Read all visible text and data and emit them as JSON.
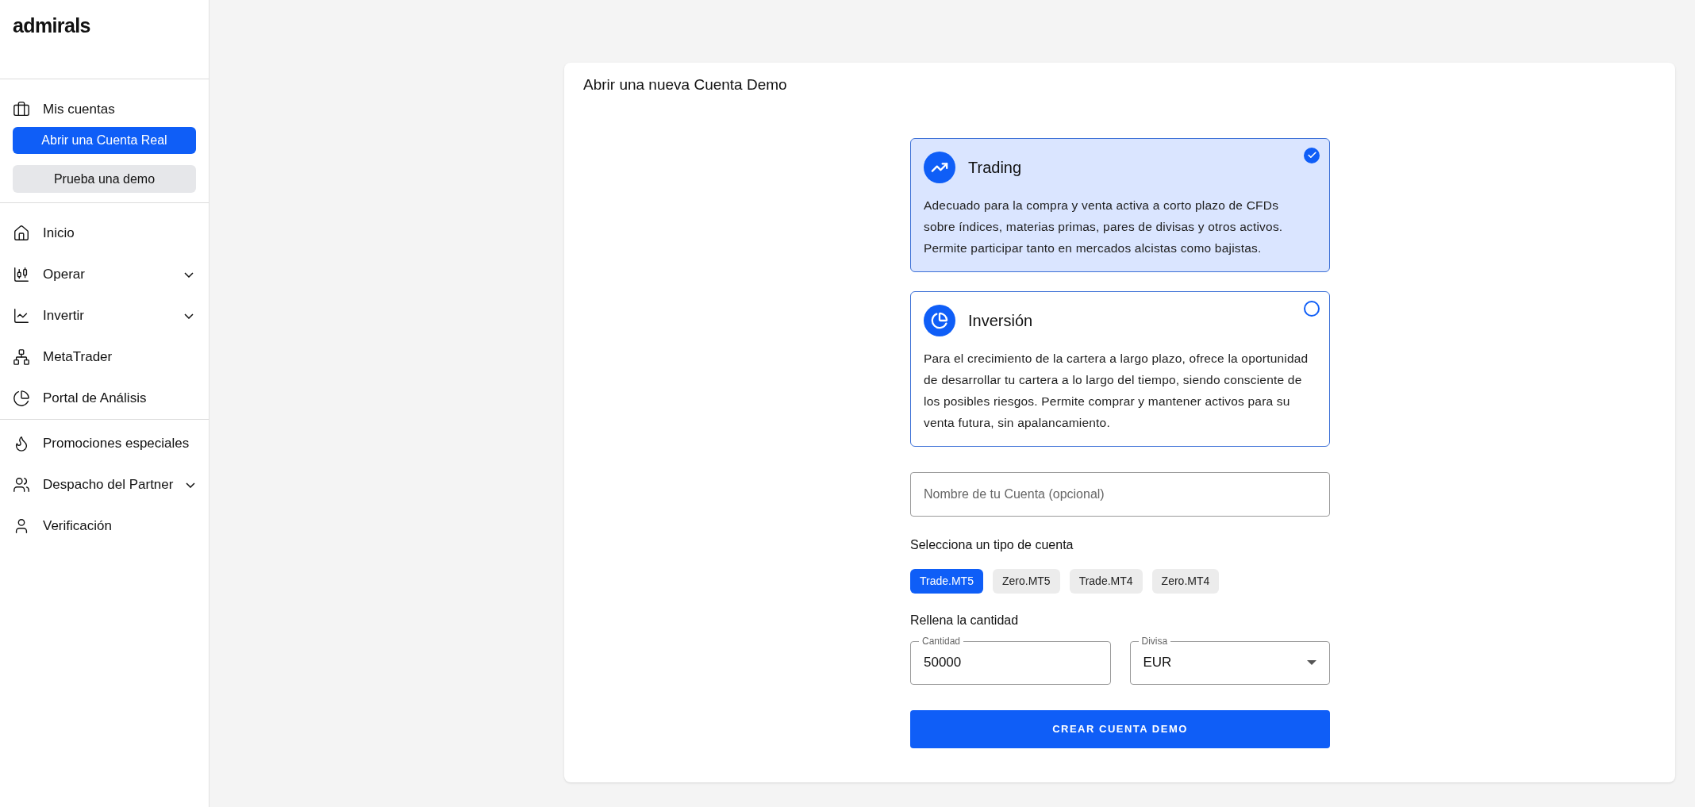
{
  "logo": "admirals",
  "sidebar": {
    "accounts": {
      "label": "Mis cuentas"
    },
    "buttons": [
      {
        "label": "Abrir una Cuenta Real",
        "kind": "primary"
      },
      {
        "label": "Prueba una demo",
        "kind": "secondary"
      }
    ],
    "groups": [
      [
        {
          "label": "Inicio",
          "expandable": false
        },
        {
          "label": "Operar",
          "expandable": true
        },
        {
          "label": "Invertir",
          "expandable": true
        },
        {
          "label": "MetaTrader",
          "expandable": false
        },
        {
          "label": "Portal de Análisis",
          "expandable": false
        }
      ],
      [
        {
          "label": "Promociones especiales",
          "expandable": false
        },
        {
          "label": "Despacho del Partner",
          "expandable": true
        },
        {
          "label": "Verificación",
          "expandable": false
        }
      ]
    ]
  },
  "card": {
    "title": "Abrir una nueva Cuenta Demo",
    "options": [
      {
        "title": "Trading",
        "selected": true,
        "description": "Adecuado para la compra y venta activa a corto plazo de CFDs sobre índices, materias primas, pares de divisas y otros activos. Permite participar tanto en mercados alcistas como bajistas."
      },
      {
        "title": "Inversión",
        "selected": false,
        "description": "Para el crecimiento de la cartera a largo plazo, ofrece la oportunidad de desarrollar tu cartera a lo largo del tiempo, siendo consciente de los posibles riesgos. Permite comprar y mantener activos para su venta futura, sin apalancamiento."
      }
    ],
    "name_field": {
      "placeholder": "Nombre de tu Cuenta (opcional)"
    },
    "account_type_label": "Selecciona un tipo de cuenta",
    "account_types": [
      {
        "label": "Trade.MT5",
        "selected": true
      },
      {
        "label": "Zero.MT5",
        "selected": false
      },
      {
        "label": "Trade.MT4",
        "selected": false
      },
      {
        "label": "Zero.MT4",
        "selected": false
      }
    ],
    "amount_label": "Rellena la cantidad",
    "amount_field": {
      "label": "Cantidad",
      "value": "50000"
    },
    "currency_field": {
      "label": "Divisa",
      "value": "EUR"
    },
    "submit": "CREAR CUENTA DEMO"
  }
}
